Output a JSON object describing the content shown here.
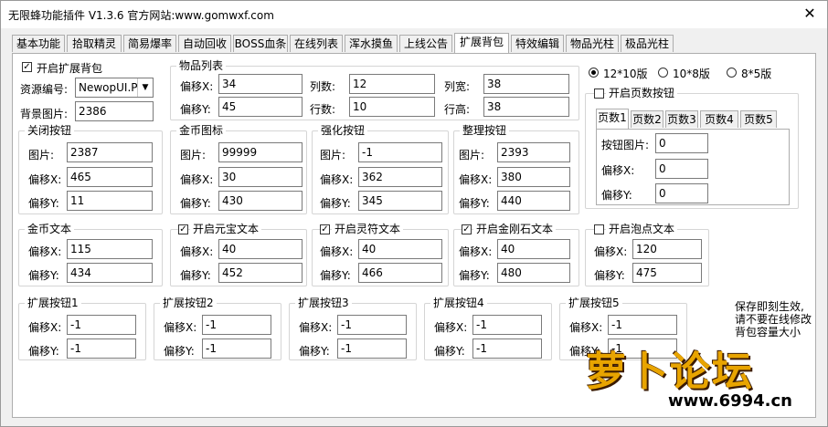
{
  "window": {
    "title": "无限蜂功能插件 V1.3.6  官方网站:www.gomwxf.com",
    "close_glyph": "✕"
  },
  "tabs": [
    "基本功能",
    "拾取精灵",
    "简易爆率",
    "自动回收",
    "BOSS血条",
    "在线列表",
    "浑水摸鱼",
    "上线公告",
    "扩展背包",
    "特效编辑",
    "物品光柱",
    "极品光柱"
  ],
  "active_tab": "扩展背包",
  "top_left": {
    "enable_label": "开启扩展背包",
    "enable_checked": true,
    "resource_label": "资源编号:",
    "resource_value": "NewopUI.Pak",
    "bg_label": "背景图片:",
    "bg_value": "2386"
  },
  "item_list": {
    "title": "物品列表",
    "offset_x_label": "偏移X:",
    "offset_x": "34",
    "offset_y_label": "偏移Y:",
    "offset_y": "45",
    "cols_label": "列数:",
    "cols": "12",
    "rows_label": "行数:",
    "rows": "10",
    "col_w_label": "列宽:",
    "col_w": "38",
    "row_h_label": "行高:",
    "row_h": "38"
  },
  "versions": {
    "options": [
      "12*10版",
      "10*8版",
      "8*5版"
    ],
    "selected_index": 0
  },
  "page_buttons": {
    "enable_label": "开启页数按钮",
    "enable_checked": false,
    "tabs": [
      "页数1",
      "页数2",
      "页数3",
      "页数4",
      "页数5"
    ],
    "active_index": 0,
    "img_label": "按钮图片:",
    "img": "0",
    "x_label": "偏移X:",
    "x": "0",
    "y_label": "偏移Y:",
    "y": "0"
  },
  "close_btn": {
    "title": "关闭按钮",
    "img_label": "图片:",
    "img": "2387",
    "x_label": "偏移X:",
    "x": "465",
    "y_label": "偏移Y:",
    "y": "11"
  },
  "gold_icon": {
    "title": "金币图标",
    "img_label": "图片:",
    "img": "99999",
    "x_label": "偏移X:",
    "x": "30",
    "y_label": "偏移Y:",
    "y": "430"
  },
  "enhance_btn": {
    "title": "强化按钮",
    "img_label": "图片:",
    "img": "-1",
    "x_label": "偏移X:",
    "x": "362",
    "y_label": "偏移Y:",
    "y": "345"
  },
  "sort_btn": {
    "title": "整理按钮",
    "img_label": "图片:",
    "img": "2393",
    "x_label": "偏移X:",
    "x": "380",
    "y_label": "偏移Y:",
    "y": "440"
  },
  "gold_text": {
    "title": "金币文本",
    "x_label": "偏移X:",
    "x": "115",
    "y_label": "偏移Y:",
    "y": "434"
  },
  "yuanbao_text": {
    "title": "开启元宝文本",
    "checked": true,
    "x_label": "偏移X:",
    "x": "40",
    "y_label": "偏移Y:",
    "y": "452"
  },
  "lingfu_text": {
    "title": "开启灵符文本",
    "checked": true,
    "x_label": "偏移X:",
    "x": "40",
    "y_label": "偏移Y:",
    "y": "466"
  },
  "diamond_text": {
    "title": "开启金刚石文本",
    "checked": true,
    "x_label": "偏移X:",
    "x": "40",
    "y_label": "偏移Y:",
    "y": "480"
  },
  "bubble_text": {
    "title": "开启泡点文本",
    "checked": false,
    "x_label": "偏移X:",
    "x": "120",
    "y_label": "偏移Y:",
    "y": "475"
  },
  "ext_buttons": [
    {
      "title": "扩展按钮1",
      "x_label": "偏移X:",
      "x": "-1",
      "y_label": "偏移Y:",
      "y": "-1"
    },
    {
      "title": "扩展按钮2",
      "x_label": "偏移X:",
      "x": "-1",
      "y_label": "偏移Y:",
      "y": "-1"
    },
    {
      "title": "扩展按钮3",
      "x_label": "偏移X:",
      "x": "-1",
      "y_label": "偏移Y:",
      "y": "-1"
    },
    {
      "title": "扩展按钮4",
      "x_label": "偏移X:",
      "x": "-1",
      "y_label": "偏移Y:",
      "y": "-1"
    },
    {
      "title": "扩展按钮5",
      "x_label": "偏移X:",
      "x": "-1",
      "y_label": "偏移Y:",
      "y": "-1"
    }
  ],
  "save_note": [
    "保存即刻生效,",
    "请不要在线修改",
    "背包容量大小"
  ],
  "watermark": {
    "text": "萝卜论坛",
    "url": "www.6994.cn"
  },
  "colors": {
    "watermark_orange": "#e8a400",
    "panel_bg": "#ffffff",
    "window_bg": "#f0f0f0"
  }
}
